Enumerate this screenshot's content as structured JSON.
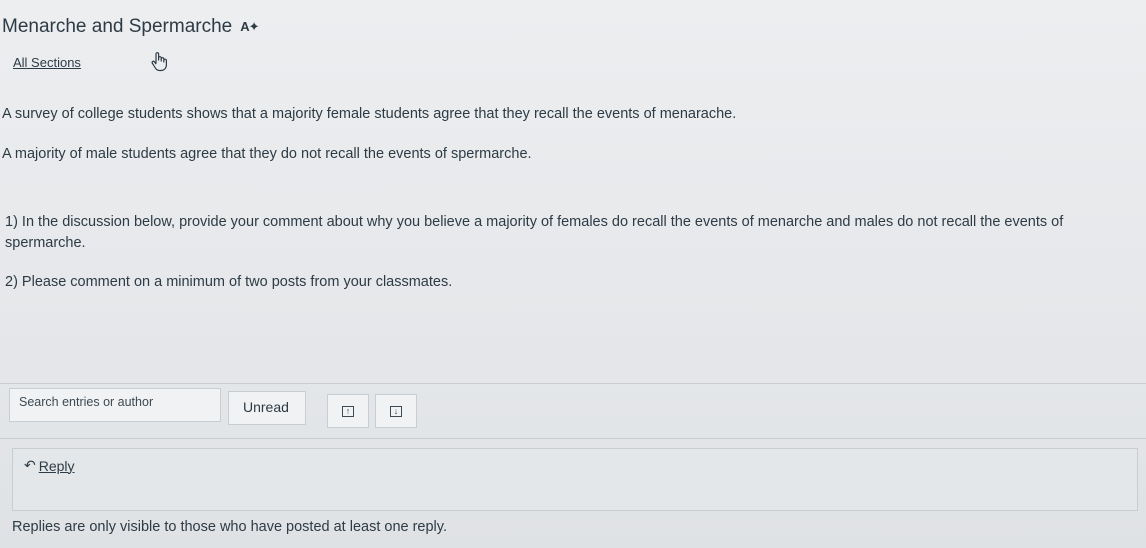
{
  "topic": {
    "title": "Menarche and Spermarche",
    "title_icon": "A✦"
  },
  "sections_link": "All Sections",
  "body": {
    "p1": "A survey of college students shows that a majority female students agree that they recall the events of menarache.",
    "p2": "A majority of male students agree that they do not recall the events of spermarche.",
    "p3": "1) In the discussion below, provide your comment about why you believe a majority of females do recall the events of menarche and males do not recall the events of spermarche.",
    "p4": "2) Please comment on a minimum of two posts from your classmates."
  },
  "toolbar": {
    "search_placeholder": "Search entries or author",
    "unread_label": "Unread",
    "expand_icon": "↑",
    "collapse_icon": "↓"
  },
  "reply": {
    "arrow": "↶",
    "label": "Reply"
  },
  "notice": "Replies are only visible to those who have posted at least one reply."
}
